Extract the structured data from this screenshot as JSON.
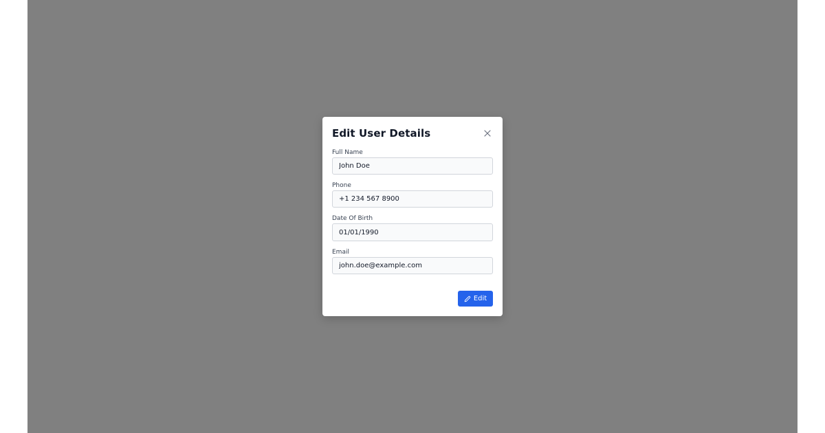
{
  "dialog": {
    "title": "Edit User Details",
    "close_icon": "close-icon"
  },
  "fields": [
    {
      "label": "Full Name",
      "value": "John Doe"
    },
    {
      "label": "Phone",
      "value": "+1 234 567 8900"
    },
    {
      "label": "Date Of Birth",
      "value": "01/01/1990"
    },
    {
      "label": "Email",
      "value": "john.doe@example.com"
    }
  ],
  "actions": {
    "edit_label": "Edit",
    "edit_icon": "pencil-icon"
  },
  "colors": {
    "backdrop": "#808080",
    "primary": "#2563eb",
    "input_bg": "#f9fafb",
    "title": "#111827"
  }
}
